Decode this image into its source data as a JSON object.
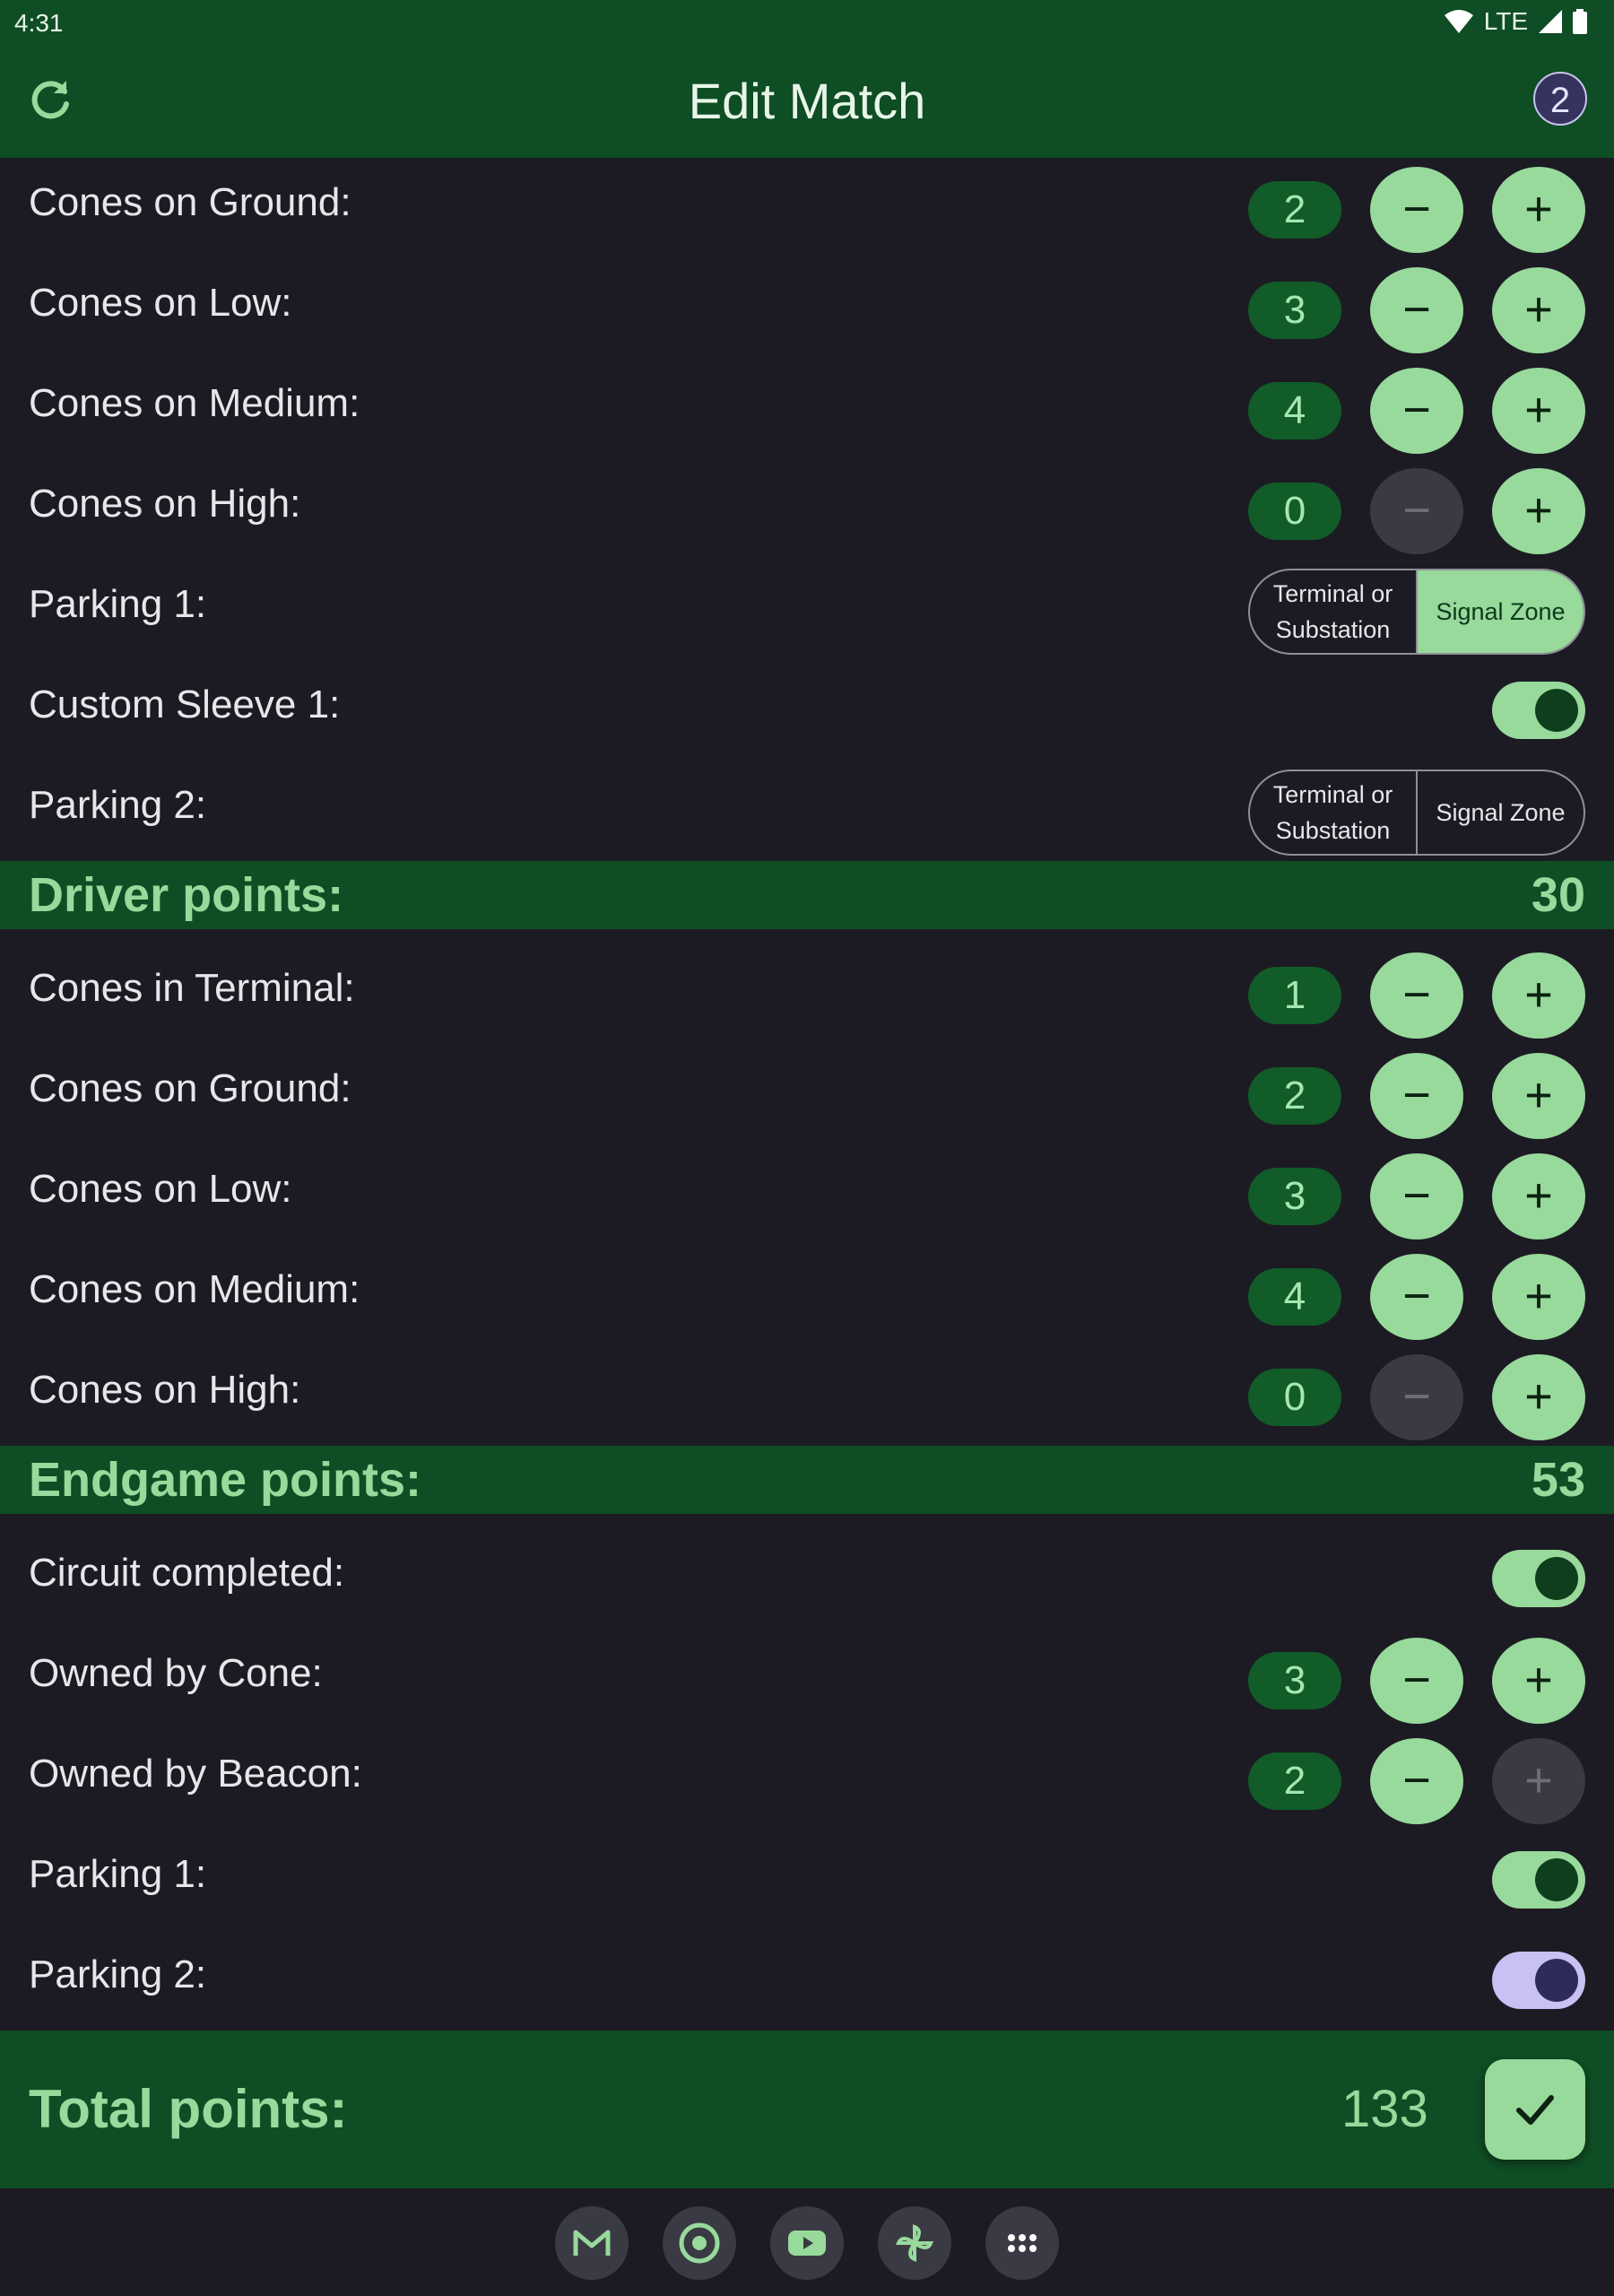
{
  "status": {
    "time": "4:31",
    "network": "LTE"
  },
  "appbar": {
    "title": "Edit Match",
    "badge": "2"
  },
  "buttons": {
    "minus": "−",
    "plus": "+"
  },
  "autonomous_rows": [
    {
      "label": "Cones on Ground:",
      "value": "2",
      "minus_enabled": true,
      "plus_enabled": true
    },
    {
      "label": "Cones on Low:",
      "value": "3",
      "minus_enabled": true,
      "plus_enabled": true
    },
    {
      "label": "Cones on Medium:",
      "value": "4",
      "minus_enabled": true,
      "plus_enabled": true
    },
    {
      "label": "Cones on High:",
      "value": "0",
      "minus_enabled": false,
      "plus_enabled": true
    }
  ],
  "parking1": {
    "label": "Parking 1:",
    "options": [
      "Terminal or Substation",
      "Signal Zone"
    ],
    "selected": "Signal Zone"
  },
  "custom_sleeve": {
    "label": "Custom Sleeve 1:",
    "on": true
  },
  "parking2": {
    "label": "Parking 2:",
    "options": [
      "Terminal or Substation",
      "Signal Zone"
    ],
    "selected": ""
  },
  "driver": {
    "title": "Driver points:",
    "value": "30",
    "rows": [
      {
        "label": "Cones in Terminal:",
        "value": "1",
        "minus_enabled": true,
        "plus_enabled": true
      },
      {
        "label": "Cones on Ground:",
        "value": "2",
        "minus_enabled": true,
        "plus_enabled": true
      },
      {
        "label": "Cones on Low:",
        "value": "3",
        "minus_enabled": true,
        "plus_enabled": true
      },
      {
        "label": "Cones on Medium:",
        "value": "4",
        "minus_enabled": true,
        "plus_enabled": true
      },
      {
        "label": "Cones on High:",
        "value": "0",
        "minus_enabled": false,
        "plus_enabled": true
      }
    ]
  },
  "endgame": {
    "title": "Endgame points:",
    "value": "53",
    "circuit": {
      "label": "Circuit completed:",
      "on": true
    },
    "owned_cone": {
      "label": "Owned by Cone:",
      "value": "3",
      "minus_enabled": true,
      "plus_enabled": true
    },
    "owned_beacon": {
      "label": "Owned by Beacon:",
      "value": "2",
      "minus_enabled": true,
      "plus_enabled": false
    },
    "parking1": {
      "label": "Parking 1:",
      "on": true
    },
    "parking2": {
      "label": "Parking 2:",
      "on": true,
      "color": "purple"
    }
  },
  "total": {
    "label": "Total points:",
    "value": "133"
  },
  "navbar": {
    "apps": [
      "gmail-icon",
      "chrome-icon",
      "youtube-icon",
      "pinwheel-icon",
      "app-drawer-icon"
    ]
  },
  "colors": {
    "primary_dark": "#0f4d24",
    "accent": "#98d99c",
    "background": "#1c1b23",
    "toggle_alt": "#c8c1f4"
  }
}
